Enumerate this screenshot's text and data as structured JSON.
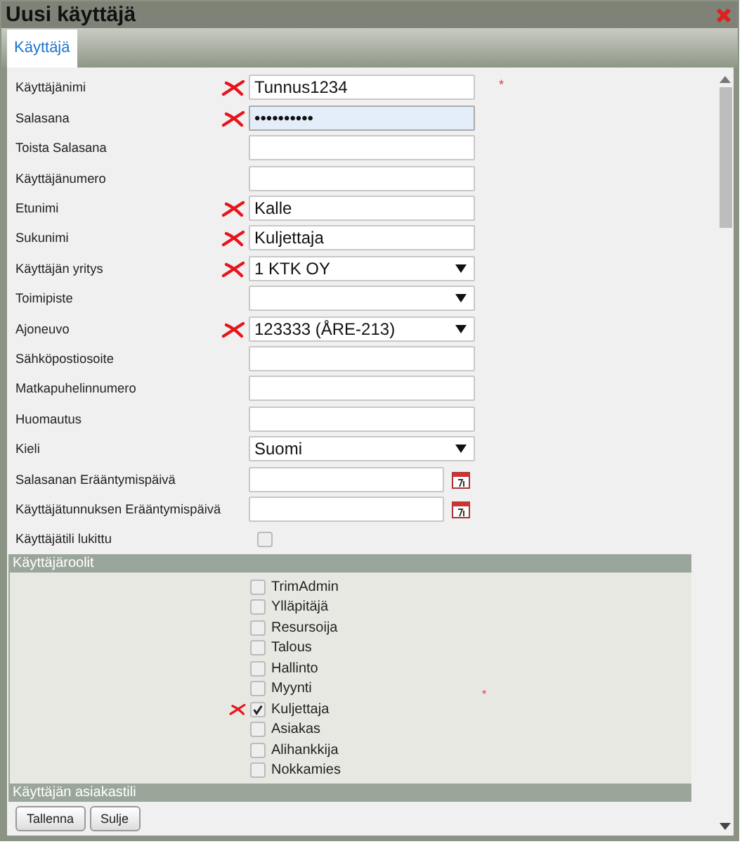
{
  "window": {
    "title": "Uusi käyttäjä"
  },
  "tabs": [
    {
      "label": "Käyttäjä",
      "selected": true
    }
  ],
  "fields": [
    {
      "label": "Käyttäjänimi",
      "kind": "text",
      "value": "Tunnus1234",
      "marked": true,
      "required_mark": "*"
    },
    {
      "label": "Salasana",
      "kind": "password",
      "value": "••••••••••",
      "marked": true,
      "focused": true
    },
    {
      "label": "Toista Salasana",
      "kind": "password",
      "marked": false
    },
    {
      "label": "Käyttäjänumero",
      "kind": "text",
      "marked": false
    },
    {
      "label": "Etunimi",
      "kind": "text",
      "value": "Kalle",
      "marked": true
    },
    {
      "label": "Sukunimi",
      "kind": "text",
      "value": "Kuljettaja",
      "marked": true
    },
    {
      "label": "Käyttäjän yritys",
      "kind": "select",
      "value": "1 KTK OY",
      "marked": true
    },
    {
      "label": "Toimipiste",
      "kind": "select",
      "marked": false
    },
    {
      "label": "Ajoneuvo",
      "kind": "select",
      "value": "123333 (ÅRE-213)",
      "marked": true
    },
    {
      "label": "Sähköpostiosoite",
      "kind": "text",
      "marked": false
    },
    {
      "label": "Matkapuhelinnumero",
      "kind": "text",
      "marked": false
    },
    {
      "label": "Huomautus",
      "kind": "text",
      "marked": false
    },
    {
      "label": "Kieli",
      "kind": "select",
      "value": "Suomi",
      "marked": false
    },
    {
      "label": "Salasanan Erääntymispäivä",
      "kind": "date",
      "marked": false
    },
    {
      "label": "Käyttäjätunnuksen Erääntymispäivä",
      "kind": "date",
      "marked": false
    },
    {
      "label": "Käyttäjätili lukittu",
      "kind": "checkbox",
      "checked": false,
      "marked": false
    }
  ],
  "roles_section": {
    "title": "Käyttäjäroolit",
    "required_mark": "*",
    "roles": [
      {
        "label": "TrimAdmin",
        "checked": false,
        "marked": false
      },
      {
        "label": "Ylläpitäjä",
        "checked": false,
        "marked": false
      },
      {
        "label": "Resursoija",
        "checked": false,
        "marked": false
      },
      {
        "label": "Talous",
        "checked": false,
        "marked": false
      },
      {
        "label": "Hallinto",
        "checked": false,
        "marked": false
      },
      {
        "label": "Myynti",
        "checked": false,
        "marked": false
      },
      {
        "label": "Kuljettaja",
        "checked": true,
        "marked": true
      },
      {
        "label": "Asiakas",
        "checked": false,
        "marked": false
      },
      {
        "label": "Alihankkija",
        "checked": false,
        "marked": false
      },
      {
        "label": "Nokkamies",
        "checked": false,
        "marked": false
      }
    ]
  },
  "account_section": {
    "title": "Käyttäjän asiakastili"
  },
  "buttons": [
    "Tallenna",
    "Sulje"
  ]
}
